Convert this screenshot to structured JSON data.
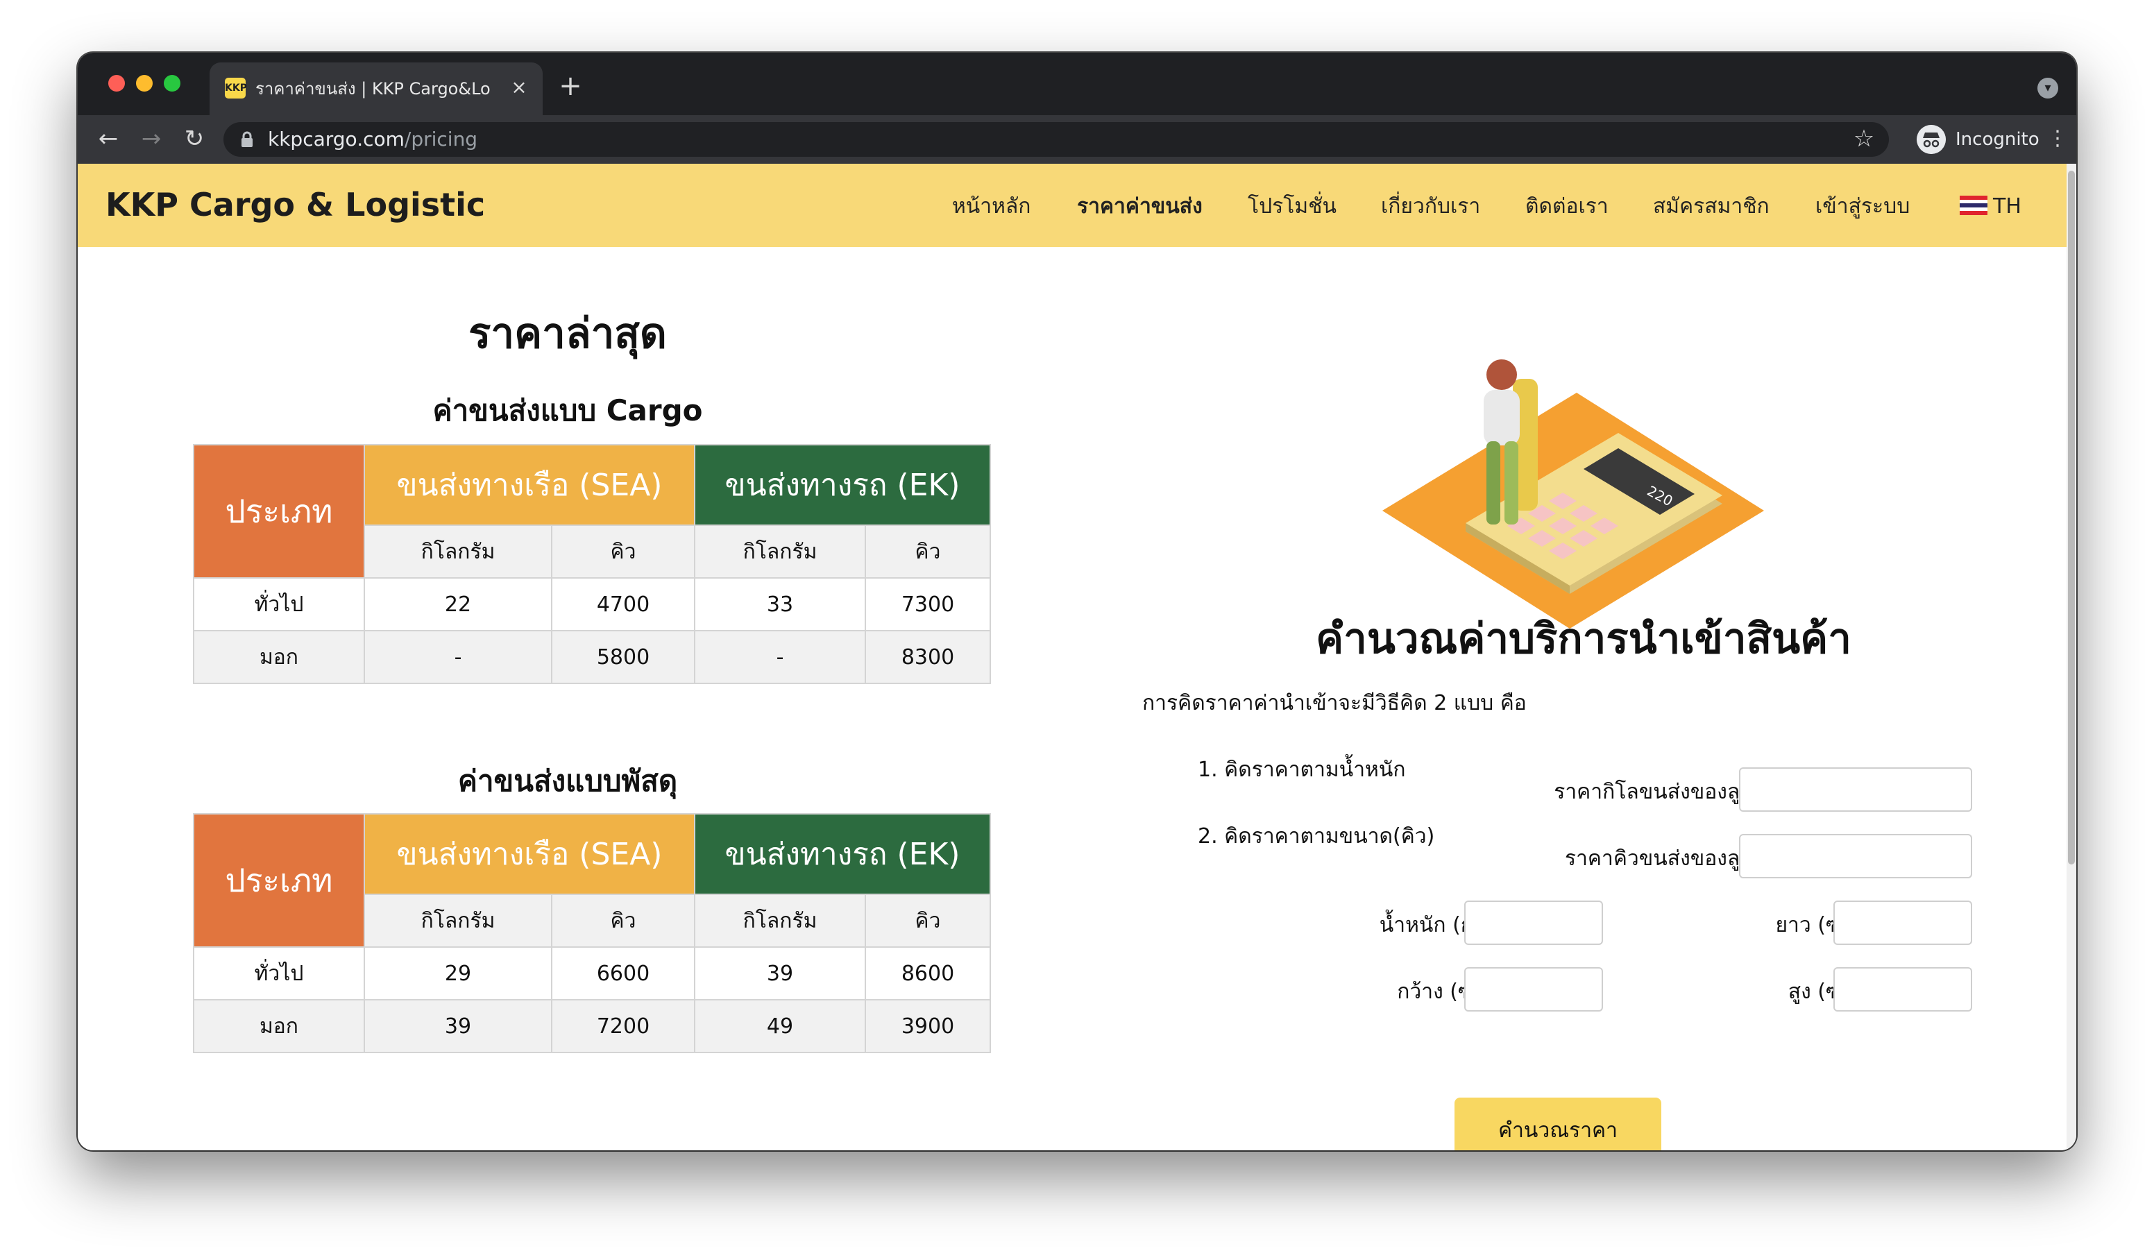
{
  "browser": {
    "tab_title": "ราคาค่าขนส่ง | KKP Cargo&Logistic",
    "tab_favicon": "KKP",
    "tab_close_icon": "×",
    "new_tab_icon": "+",
    "url_host": "kkpcargo.com",
    "url_path": "/pricing",
    "incognito_label": "Incognito"
  },
  "site": {
    "brand": "KKP Cargo & Logistic",
    "nav": [
      "หน้าหลัก",
      "ราคาค่าขนส่ง",
      "โปรโมชั่น",
      "เกี่ยวกับเรา",
      "ติดต่อเรา",
      "สมัครสมาชิก",
      "เข้าสู่ระบบ"
    ],
    "lang": "TH"
  },
  "pricing": {
    "title": "ราคาล่าสุด",
    "cargo": {
      "title": "ค่าขนส่งแบบ Cargo",
      "type_header": "ประเภท",
      "sea_header": "ขนส่งทางเรือ (SEA)",
      "ek_header": "ขนส่งทางรถ (EK)",
      "units": [
        "กิโลกรัม",
        "คิว",
        "กิโลกรัม",
        "คิว"
      ],
      "rows": [
        {
          "type": "ทั่วไป",
          "sea_kg": "22",
          "sea_cbm": "4700",
          "ek_kg": "33",
          "ek_cbm": "7300"
        },
        {
          "type": "มอก",
          "sea_kg": "-",
          "sea_cbm": "5800",
          "ek_kg": "-",
          "ek_cbm": "8300"
        }
      ]
    },
    "parcel": {
      "title": "ค่าขนส่งแบบพัสดุ",
      "type_header": "ประเภท",
      "sea_header": "ขนส่งทางเรือ (SEA)",
      "ek_header": "ขนส่งทางรถ (EK)",
      "units": [
        "กิโลกรัม",
        "คิว",
        "กิโลกรัม",
        "คิว"
      ],
      "rows": [
        {
          "type": "ทั่วไป",
          "sea_kg": "29",
          "sea_cbm": "6600",
          "ek_kg": "39",
          "ek_cbm": "8600"
        },
        {
          "type": "มอก",
          "sea_kg": "39",
          "sea_cbm": "7200",
          "ek_kg": "49",
          "ek_cbm": "3900"
        }
      ]
    }
  },
  "calculator": {
    "title": "คำนวณค่าบริการนำเข้าสินค้า",
    "description": "การคิดราคาค่านำเข้าจะมีวิธีคิด 2 แบบ คือ",
    "method_1": "1. คิดราคาตามน้ำหนัก",
    "method_2": "2. คิดราคาตามขนาด(คิว)",
    "kg_rate_label": "ราคากิโลขนส่งของลูกค้า :",
    "cbm_rate_label": "ราคาคิวขนส่งของลูกค้า :",
    "weight_label": "น้ำหนัก (กก.) :",
    "length_label": "ยาว (ซม.) :",
    "width_label": "กว้าง (ซม.) :",
    "height_label": "สูง (ซม.) :",
    "button": "คำนวณราคา",
    "inputs": {
      "kg_rate": "",
      "cbm_rate": "",
      "weight": "",
      "length": "",
      "width": "",
      "height": ""
    }
  },
  "colors": {
    "nav_bg": "#f8d978",
    "type_header": "#e1753e",
    "sea_header": "#f0b246",
    "ek_header": "#2c6b3f",
    "button": "#f8d761"
  },
  "icons": {
    "back": "arrow-left-icon",
    "forward": "arrow-right-icon",
    "reload": "reload-icon",
    "lock": "lock-icon",
    "bookmark": "star-icon",
    "incognito": "incognito-icon",
    "menu": "kebab-menu-icon",
    "flag": "thai-flag-icon"
  }
}
